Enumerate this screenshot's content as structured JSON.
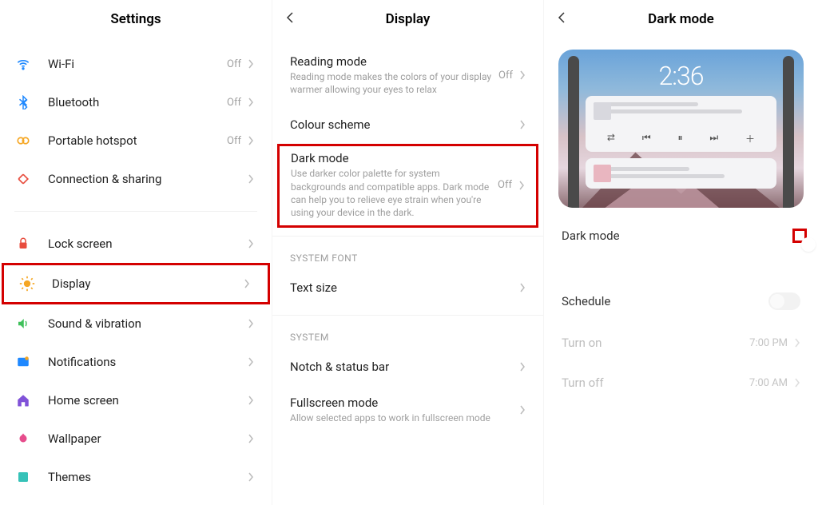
{
  "pane1": {
    "title": "Settings",
    "items": [
      {
        "label": "Wi-Fi",
        "status": "Off",
        "icon": "wifi-icon"
      },
      {
        "label": "Bluetooth",
        "status": "Off",
        "icon": "bluetooth-icon"
      },
      {
        "label": "Portable hotspot",
        "status": "Off",
        "icon": "hotspot-icon"
      },
      {
        "label": "Connection & sharing",
        "status": "",
        "icon": "sharing-icon"
      },
      {
        "label": "Lock screen",
        "status": "",
        "icon": "lock-icon"
      },
      {
        "label": "Display",
        "status": "",
        "icon": "sun-icon",
        "highlight": true
      },
      {
        "label": "Sound & vibration",
        "status": "",
        "icon": "sound-icon"
      },
      {
        "label": "Notifications",
        "status": "",
        "icon": "notif-icon"
      },
      {
        "label": "Home screen",
        "status": "",
        "icon": "home-icon"
      },
      {
        "label": "Wallpaper",
        "status": "",
        "icon": "wallpaper-icon"
      },
      {
        "label": "Themes",
        "status": "",
        "icon": "themes-icon"
      }
    ]
  },
  "pane2": {
    "title": "Display",
    "items": [
      {
        "title": "Reading mode",
        "sub": "Reading mode makes the colors of your display warmer allowing your eyes to relax",
        "status": "Off"
      },
      {
        "title": "Colour scheme",
        "sub": "",
        "status": ""
      },
      {
        "title": "Dark mode",
        "sub": "Use darker color palette for system backgrounds and compatible apps. Dark mode can help you to relieve eye strain when you're using your device in the dark.",
        "status": "Off",
        "highlight": true
      }
    ],
    "section_font": "SYSTEM FONT",
    "textsize": {
      "title": "Text size"
    },
    "section_system": "SYSTEM",
    "notch": {
      "title": "Notch & status bar"
    },
    "fullscreen": {
      "title": "Fullscreen mode",
      "sub": "Allow selected apps to work in fullscreen mode"
    }
  },
  "pane3": {
    "title": "Dark mode",
    "preview_time": "2:36",
    "darkmode_label": "Dark mode",
    "schedule_label": "Schedule",
    "turn_on": {
      "label": "Turn on",
      "value": "7:00 PM"
    },
    "turn_off": {
      "label": "Turn off",
      "value": "7:00 AM"
    }
  }
}
